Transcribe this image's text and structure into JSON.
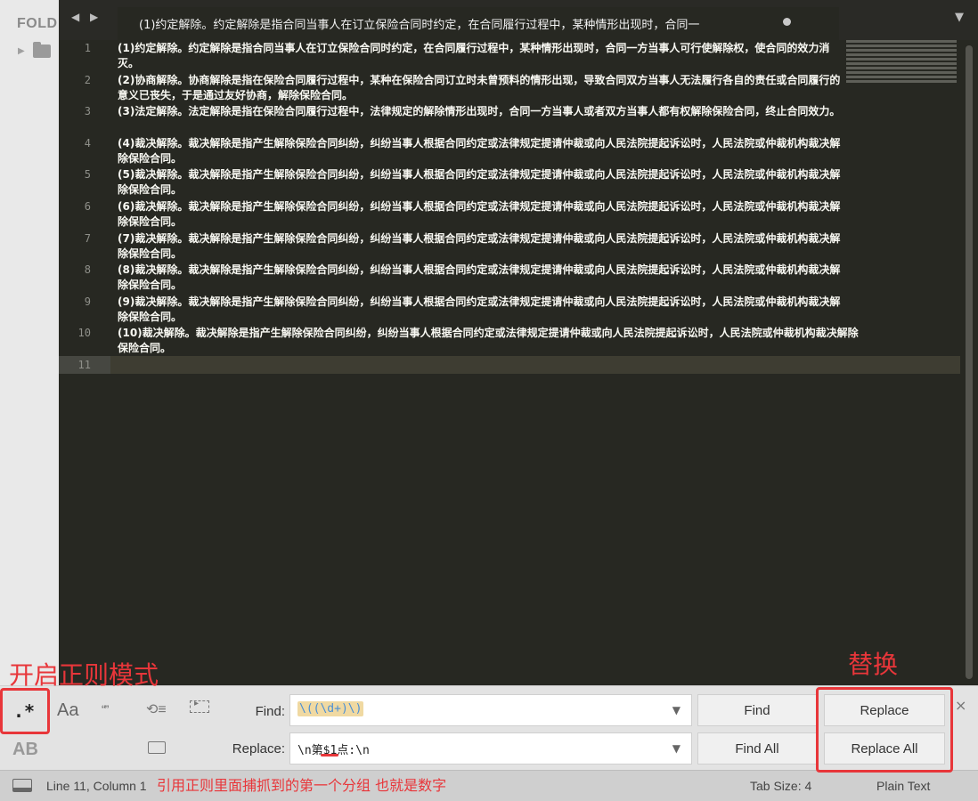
{
  "sidebar": {
    "title": "FOLD"
  },
  "tab": {
    "title": "(1)约定解除。约定解除是指合同当事人在订立保险合同时约定，在合同履行过程中，某种情形出现时，合同一"
  },
  "editor": {
    "lines": [
      {
        "num": "1",
        "text": "(1)约定解除。约定解除是指合同当事人在订立保险合同时约定，在合同履行过程中，某种情形出现时，合同一方当事人可行使解除权，使合同的效力消灭。"
      },
      {
        "num": "2",
        "text": "(2)协商解除。协商解除是指在保险合同履行过程中，某种在保险合同订立时未曾预料的情形出现，导致合同双方当事人无法履行各自的责任或合同履行的意义已丧失，于是通过友好协商，解除保险合同。"
      },
      {
        "num": "3",
        "text": "(3)法定解除。法定解除是指在保险合同履行过程中，法律规定的解除情形出现时，合同一方当事人或者双方当事人都有权解除保险合同，终止合同效力。"
      },
      {
        "num": "4",
        "text": "(4)裁决解除。裁决解除是指产生解除保险合同纠纷，纠纷当事人根据合同约定或法律规定提请仲裁或向人民法院提起诉讼时，人民法院或仲裁机构裁决解除保险合同。"
      },
      {
        "num": "5",
        "text": "(5)裁决解除。裁决解除是指产生解除保险合同纠纷，纠纷当事人根据合同约定或法律规定提请仲裁或向人民法院提起诉讼时，人民法院或仲裁机构裁决解除保险合同。"
      },
      {
        "num": "6",
        "text": "(6)裁决解除。裁决解除是指产生解除保险合同纠纷，纠纷当事人根据合同约定或法律规定提请仲裁或向人民法院提起诉讼时，人民法院或仲裁机构裁决解除保险合同。"
      },
      {
        "num": "7",
        "text": "(7)裁决解除。裁决解除是指产生解除保险合同纠纷，纠纷当事人根据合同约定或法律规定提请仲裁或向人民法院提起诉讼时，人民法院或仲裁机构裁决解除保险合同。"
      },
      {
        "num": "8",
        "text": "(8)裁决解除。裁决解除是指产生解除保险合同纠纷，纠纷当事人根据合同约定或法律规定提请仲裁或向人民法院提起诉讼时，人民法院或仲裁机构裁决解除保险合同。"
      },
      {
        "num": "9",
        "text": "(9)裁决解除。裁决解除是指产生解除保险合同纠纷，纠纷当事人根据合同约定或法律规定提请仲裁或向人民法院提起诉讼时，人民法院或仲裁机构裁决解除保险合同。"
      },
      {
        "num": "10",
        "text": "(10)裁决解除。裁决解除是指产生解除保险合同纠纷，纠纷当事人根据合同约定或法律规定提请仲裁或向人民法院提起诉讼时，人民法院或仲裁机构裁决解除保险合同。"
      },
      {
        "num": "11",
        "text": ""
      }
    ]
  },
  "find_panel": {
    "regex_label": ".*",
    "case_label": "Aa",
    "word_label": "“”",
    "wrap_label": "⟲≡",
    "case_ab_label": "AB",
    "find_label": "Find:",
    "find_value": "\\((\\d+)\\)",
    "replace_label": "Replace:",
    "replace_value": "\\n第$1点:\\n",
    "find_button": "Find",
    "find_all_button": "Find All",
    "replace_button": "Replace",
    "replace_all_button": "Replace All",
    "close": "×"
  },
  "status_bar": {
    "position": "Line 11, Column 1",
    "tab_size": "Tab Size: 4",
    "syntax": "Plain Text"
  },
  "annotations": {
    "regex_mode": "开启正则模式",
    "replace": "替换",
    "group_note": "引用正则里面捕抓到的第一个分组 也就是数字"
  },
  "colors": {
    "annotation": "#e8363a",
    "editor_bg": "#272822"
  }
}
